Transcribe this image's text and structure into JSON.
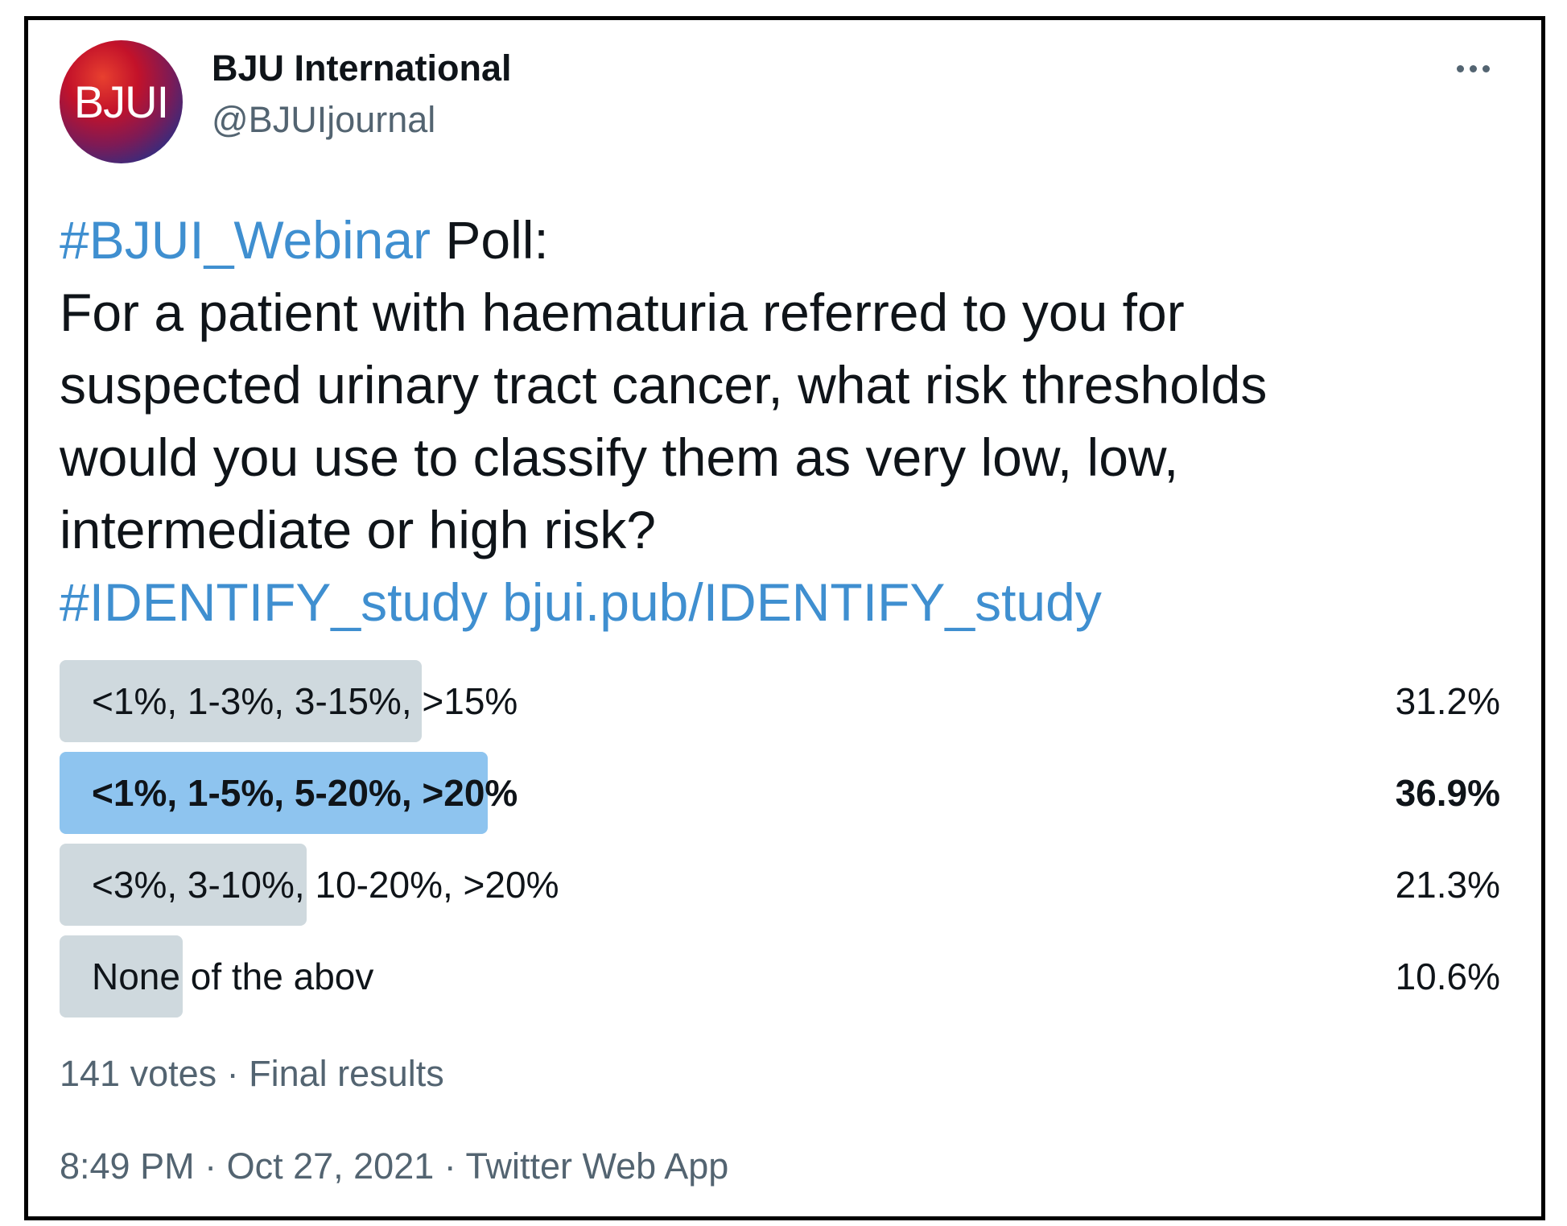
{
  "author": {
    "avatar_text": "BJUI",
    "name": "BJU International",
    "handle": "@BJUIjournal"
  },
  "more_icon": "more-horizontal-icon",
  "tweet": {
    "hashtag1": "#BJUI_Webinar",
    "poll_word": " Poll:",
    "line2": "For a patient with haematuria referred to you for",
    "line3": "suspected urinary tract cancer, what risk thresholds",
    "line4": "would you use to classify them as very low, low,",
    "line5": "intermediate or high risk?",
    "hashtag2": "#IDENTIFY_study",
    "link": "bjui.pub/IDENTIFY_study"
  },
  "poll": {
    "options": [
      {
        "label": "<1%, 1-3%, 3-15%, >15%",
        "percent": "31.2%",
        "fraction": 0.312,
        "winner": false
      },
      {
        "label": "<1%, 1-5%, 5-20%, >20%",
        "percent": "36.9%",
        "fraction": 0.369,
        "winner": true
      },
      {
        "label": "<3%, 3-10%, 10-20%, >20%",
        "percent": "21.3%",
        "fraction": 0.213,
        "winner": false
      },
      {
        "label": "None of the abov",
        "percent": "10.6%",
        "fraction": 0.106,
        "winner": false
      }
    ],
    "votes": "141 votes",
    "separator": " · ",
    "status": "Final results"
  },
  "meta": {
    "time": "8:49 PM",
    "date": "Oct 27, 2021",
    "source": "Twitter Web App",
    "separator": " · "
  },
  "colors": {
    "link": "#3f8fd0",
    "bar": "#cfd9de",
    "bar_winner": "#8ec4ef",
    "text": "#0f1419",
    "muted": "#536471"
  }
}
